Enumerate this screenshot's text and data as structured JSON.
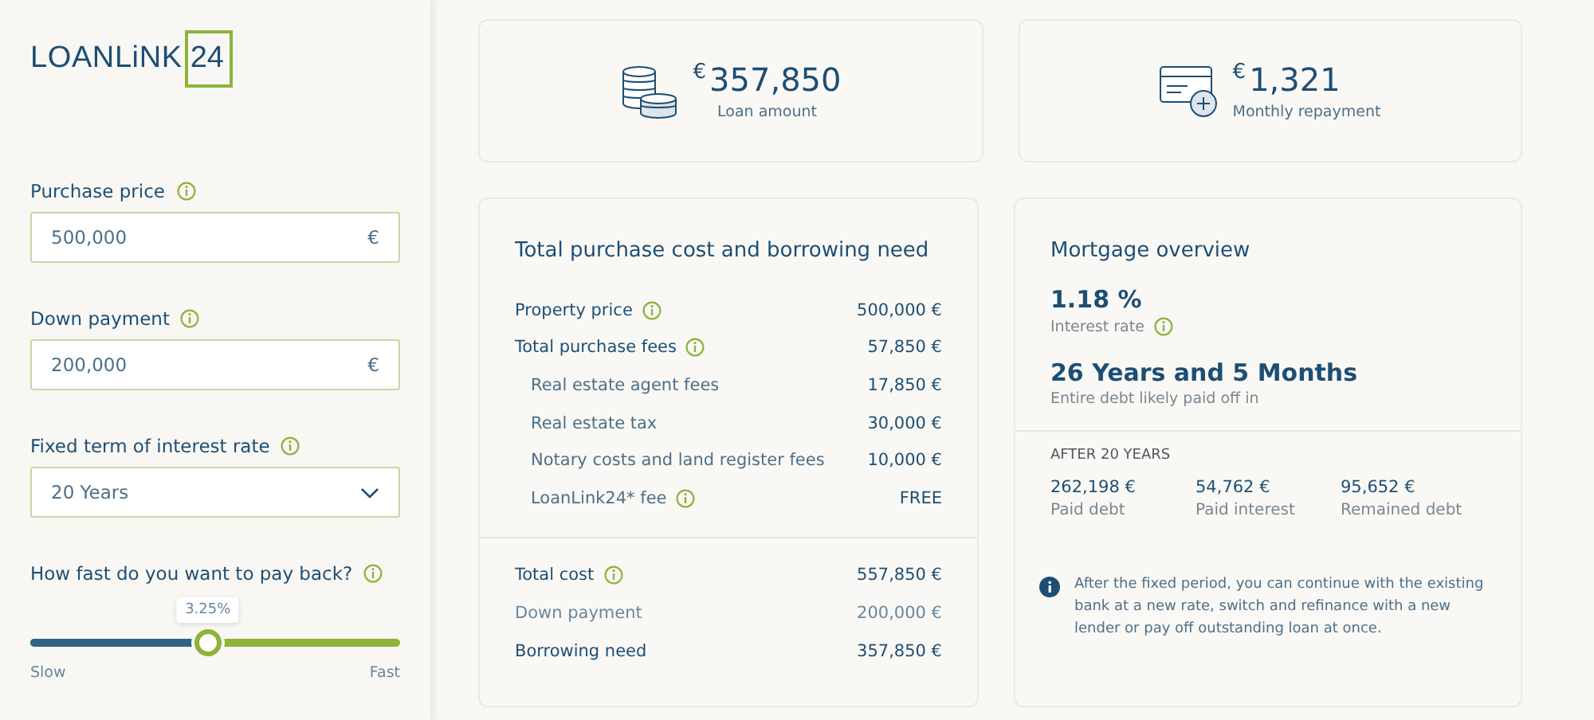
{
  "logo": {
    "name": "LOANLiNK",
    "number": "24"
  },
  "form": {
    "fields": [
      {
        "kind": "input",
        "label": "Purchase price",
        "info": true,
        "value": "500,000",
        "unit": "€"
      },
      {
        "kind": "input",
        "label": "Down payment",
        "info": true,
        "value": "200,000",
        "unit": "€"
      },
      {
        "kind": "select",
        "label": "Fixed term of interest rate",
        "info": true,
        "value": "20 Years"
      },
      {
        "kind": "slider",
        "label": "How fast do you want to pay back?",
        "info": true,
        "tooltip": "3.25%",
        "level": 0.48,
        "min_label": "Slow",
        "max_label": "Fast"
      }
    ]
  },
  "summary": [
    {
      "kind": "coins",
      "currency": "€",
      "amount": "357,850",
      "caption": "Loan amount"
    },
    {
      "kind": "card",
      "currency": "€",
      "amount": "1,321",
      "caption": "Monthly repayment"
    }
  ],
  "cost": {
    "title": "Total purchase cost and borrowing need",
    "groups": [
      [
        {
          "kind": "main",
          "label": "Property price",
          "info": true,
          "value": "500,000 €"
        },
        {
          "kind": "main",
          "label": "Total purchase fees",
          "info": true,
          "value": "57,850 €"
        },
        {
          "kind": "sub",
          "label": "Real estate agent fees",
          "info": false,
          "value": "17,850 €"
        },
        {
          "kind": "sub",
          "label": "Real estate tax",
          "info": false,
          "value": "30,000 €"
        },
        {
          "kind": "sub",
          "label": "Notary costs and land register fees",
          "info": false,
          "value": "10,000 €"
        },
        {
          "kind": "sub",
          "label": "LoanLink24* fee",
          "info": true,
          "value": "FREE"
        }
      ],
      [
        {
          "kind": "main",
          "label": "Total cost",
          "info": true,
          "value": "557,850 €"
        },
        {
          "kind": "muted",
          "label": "Down payment",
          "info": false,
          "value": "200,000 €"
        },
        {
          "kind": "main",
          "label": "Borrowing need",
          "info": false,
          "value": "357,850 €"
        }
      ]
    ]
  },
  "overview": {
    "title": "Mortgage overview",
    "stats": [
      {
        "value": "1.18 %",
        "caption": "Interest rate",
        "info": true
      },
      {
        "value": "26 Years and 5 Months",
        "caption": "Entire debt likely paid off in",
        "info": false
      }
    ],
    "period_title": "AFTER 20 YEARS",
    "period_values": [
      {
        "value": "262,198 €",
        "caption": "Paid debt"
      },
      {
        "value": "54,762 €",
        "caption": "Paid interest"
      },
      {
        "value": "95,652 €",
        "caption": "Remained debt"
      }
    ],
    "note": "After the fixed period, you can continue with the existing bank at a new rate, switch and refinance with a new lender or pay off outstanding loan at once."
  }
}
